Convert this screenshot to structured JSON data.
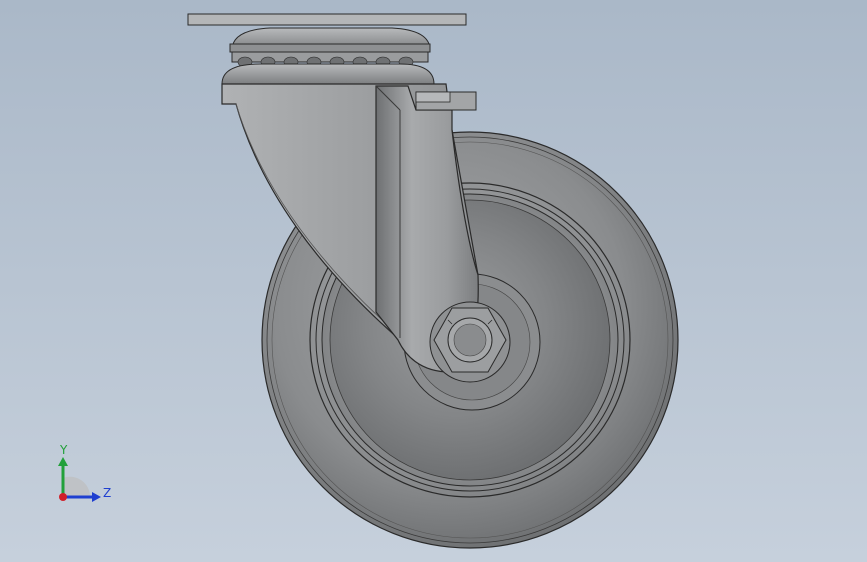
{
  "viewport": {
    "background_top": "#aab8c8",
    "background_bottom": "#c6d0dc"
  },
  "triad": {
    "y_label": "Y",
    "z_label": "Z",
    "colors": {
      "y": "#22a03a",
      "z": "#1f3fd0",
      "x": "#d0202a"
    }
  },
  "model": {
    "name_icon": "swivel-caster-wheel",
    "colors": {
      "body": "#8d8f91",
      "light": "#b3b5b7",
      "dark": "#595b5d",
      "edge": "#2a2a2a"
    }
  }
}
